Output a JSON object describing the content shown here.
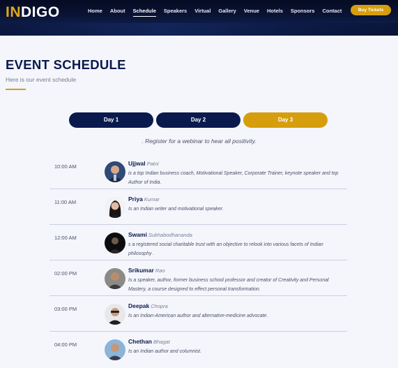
{
  "brand": {
    "logo_accent": "IN",
    "logo_rest": "DIGO",
    "accent_color": "#d69e0c",
    "navy_color": "#0b1a4d"
  },
  "nav": {
    "items": [
      {
        "label": "Home",
        "active": false
      },
      {
        "label": "About",
        "active": false
      },
      {
        "label": "Schedule",
        "active": true
      },
      {
        "label": "Speakers",
        "active": false
      },
      {
        "label": "Virtual",
        "active": false
      },
      {
        "label": "Gallery",
        "active": false
      },
      {
        "label": "Venue",
        "active": false
      },
      {
        "label": "Hotels",
        "active": false
      },
      {
        "label": "Sponsors",
        "active": false
      },
      {
        "label": "Contact",
        "active": false
      }
    ],
    "cta_label": "Buy Tickets"
  },
  "section": {
    "title": "EVENT SCHEDULE",
    "subtitle": "Here is our event schedule"
  },
  "tabs": [
    {
      "label": "Day 1",
      "active": false
    },
    {
      "label": "Day 2",
      "active": false
    },
    {
      "label": "Day 3",
      "active": true
    }
  ],
  "register_text": ". Register for a webinar to hear all positivity.",
  "schedule": [
    {
      "time": "10:00 AM",
      "first": "Ujjwal",
      "last": "Patni",
      "desc": "is a top Indian business coach, Motivational Speaker, Corporate Trainer, keynote speaker and top Author of India.",
      "avatar_icon": "speaker-photo-icon"
    },
    {
      "time": "11:00 AM",
      "first": "Priya",
      "last": "Kumar",
      "desc": "Is an Indian writer and motivational speaker.",
      "avatar_icon": "speaker-photo-icon"
    },
    {
      "time": "12:00 AM",
      "first": "Swami",
      "last": "Sukhabodhananda",
      "desc": "s a registered social charitable trust with an objective to relook into various facets of Indian philosophy .",
      "avatar_icon": "speaker-photo-icon"
    },
    {
      "time": "02:00 PM",
      "first": "Srikumar",
      "last": "Rao",
      "desc": "Is a speaker, author, former business school professor and creator of Creativity and Personal Mastery, a course designed to effect personal transformation.",
      "avatar_icon": "speaker-photo-icon"
    },
    {
      "time": "03:00 PM",
      "first": "Deepak",
      "last": "Chopra",
      "desc": "Is an Indian-American author and alternative-medicine advocate.",
      "avatar_icon": "speaker-photo-icon"
    },
    {
      "time": "04:00 PM",
      "first": "Chethan",
      "last": "Bhagat",
      "desc": "Is an Indian author and columnist.",
      "avatar_icon": "speaker-photo-icon"
    }
  ]
}
